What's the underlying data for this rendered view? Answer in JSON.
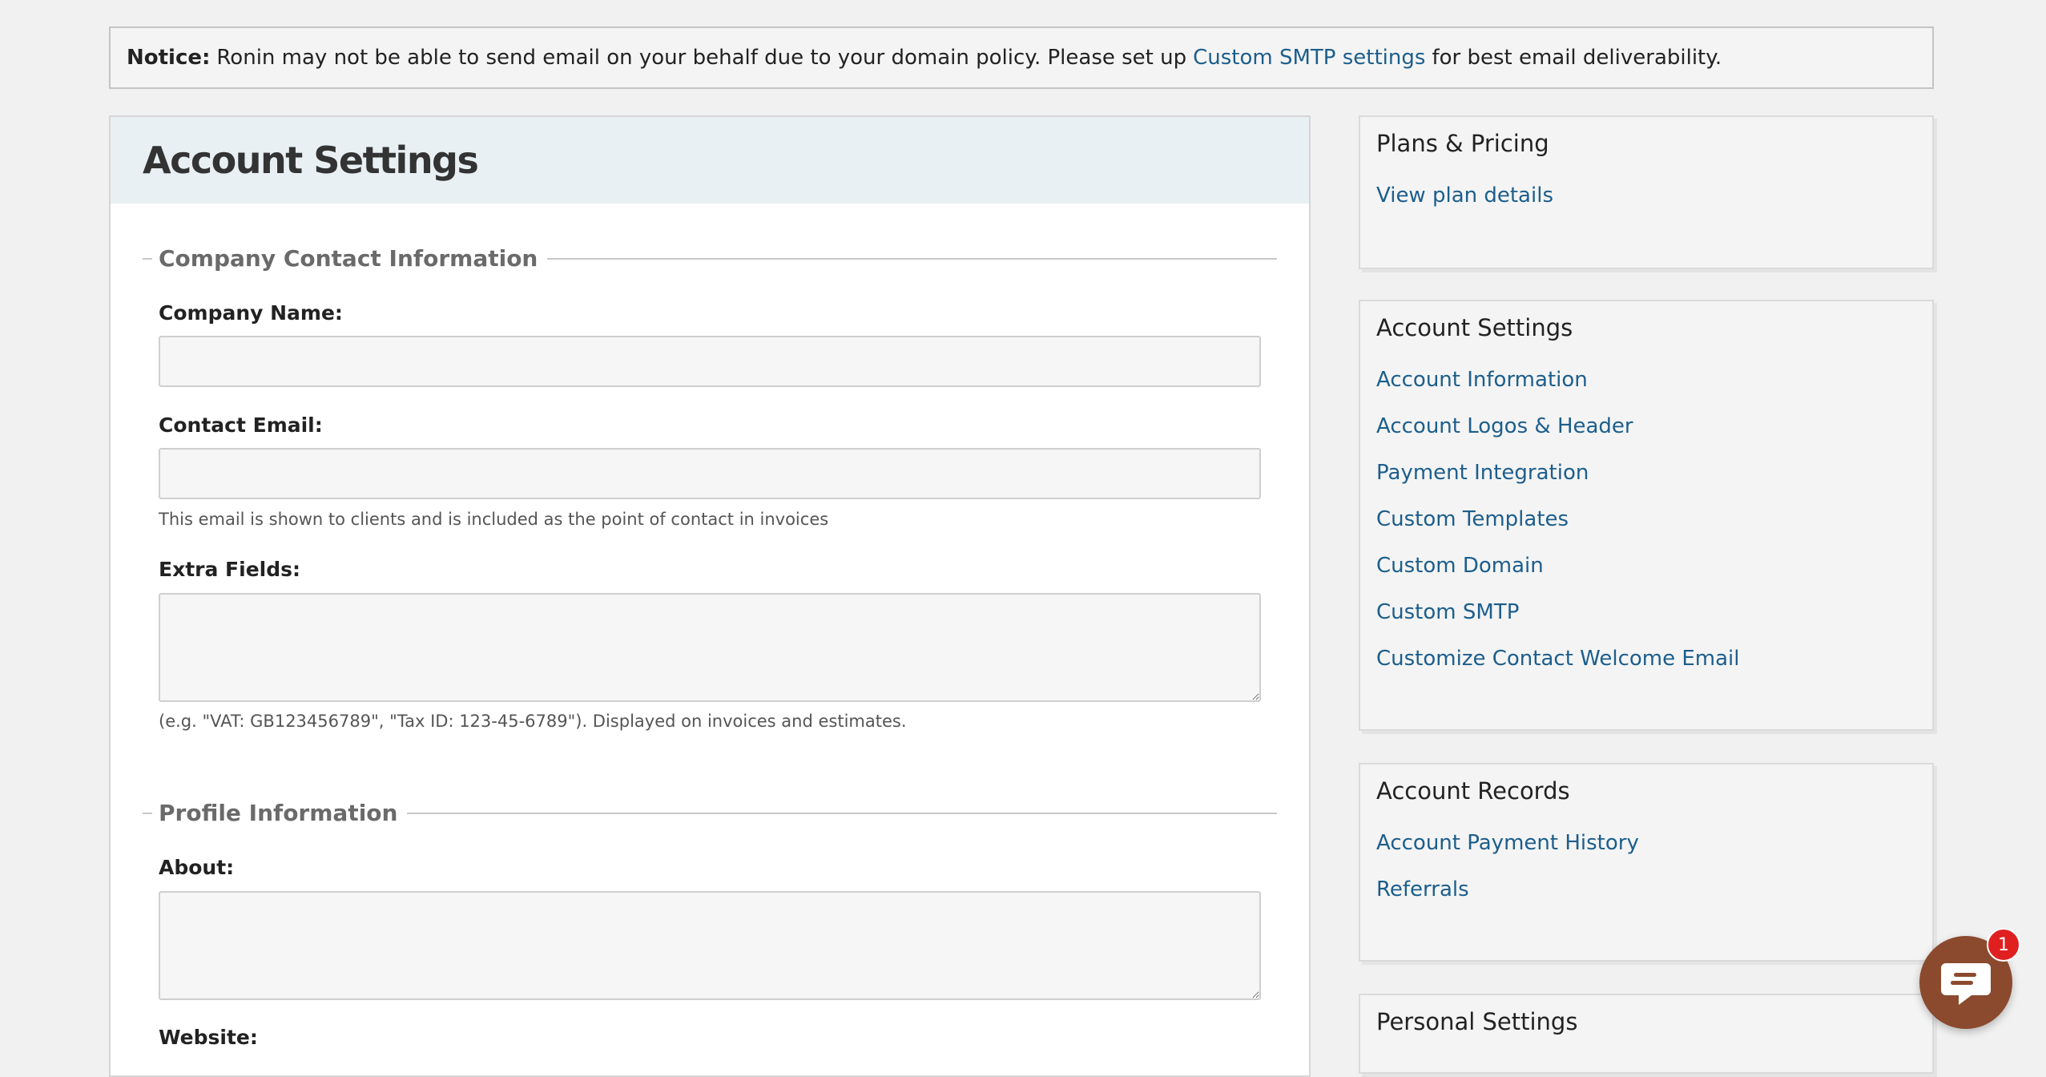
{
  "notice": {
    "label": "Notice:",
    "text_before": "Ronin may not be able to send email on your behalf due to your domain policy. Please set up",
    "link_text": "Custom SMTP settings",
    "text_after": "for best email deliverability."
  },
  "main": {
    "title": "Account Settings",
    "company_section": {
      "legend": "Company Contact Information",
      "company_name_label": "Company Name:",
      "company_name_value": "",
      "contact_email_label": "Contact Email:",
      "contact_email_value": "",
      "contact_email_help": "This email is shown to clients and is included as the point of contact in invoices",
      "extra_fields_label": "Extra Fields:",
      "extra_fields_value": "",
      "extra_fields_help": "(e.g. \"VAT: GB123456789\", \"Tax ID: 123-45-6789\"). Displayed on invoices and estimates."
    },
    "profile_section": {
      "legend": "Profile Information",
      "about_label": "About:",
      "about_value": "",
      "website_label": "Website:"
    }
  },
  "sidebar": {
    "plans": {
      "title": "Plans & Pricing",
      "links": [
        "View plan details"
      ]
    },
    "account_settings": {
      "title": "Account Settings",
      "links": [
        "Account Information",
        "Account Logos & Header",
        "Payment Integration",
        "Custom Templates",
        "Custom Domain",
        "Custom SMTP",
        "Customize Contact Welcome Email"
      ]
    },
    "account_records": {
      "title": "Account Records",
      "links": [
        "Account Payment History",
        "Referrals"
      ]
    },
    "personal_settings": {
      "title": "Personal Settings"
    }
  },
  "chat": {
    "badge_count": "1",
    "icon": "chat-bubble-icon",
    "color": "#8b4a2e",
    "badge_color": "#e02020"
  },
  "colors": {
    "link": "#1c5e8c",
    "background": "#f1f1f1",
    "header_band": "#e9f0f3"
  }
}
